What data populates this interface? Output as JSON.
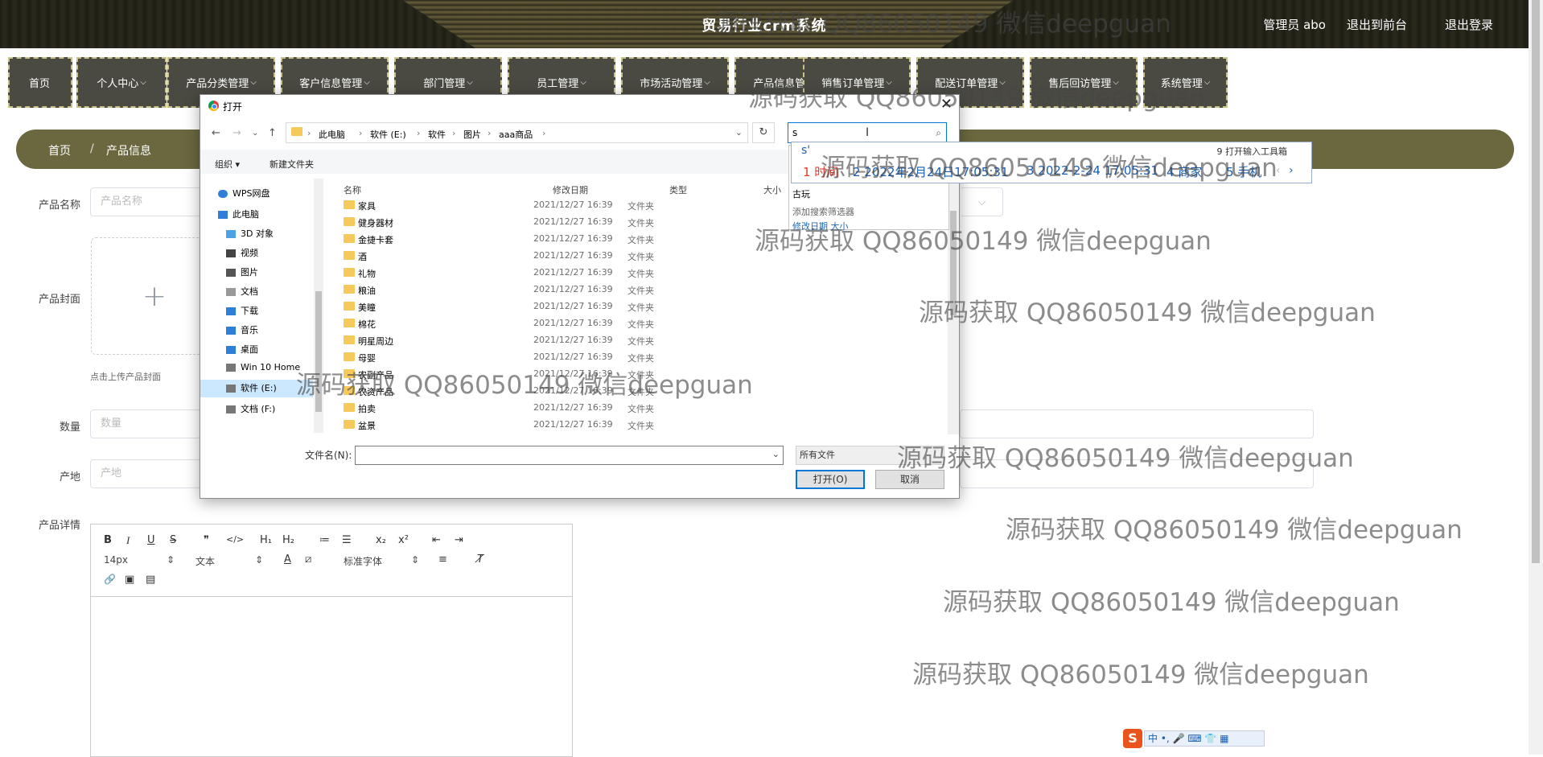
{
  "header": {
    "site_title": "贸易行业crm系统",
    "admin_label": "管理员 abo",
    "front_link": "退出到前台",
    "logout_link": "退出登录"
  },
  "nav": [
    {
      "label": "首页",
      "caret": ""
    },
    {
      "label": "个人中心",
      "caret": "⌵"
    },
    {
      "label": "产品分类管理",
      "caret": "⌵"
    },
    {
      "label": "客户信息管理",
      "caret": "⌵"
    },
    {
      "label": "部门管理",
      "caret": "⌵"
    },
    {
      "label": "员工管理",
      "caret": "⌵"
    },
    {
      "label": "市场活动管理",
      "caret": "⌵"
    },
    {
      "label": "产品信息管理",
      "caret": "⌵"
    },
    {
      "label": "销售订单管理",
      "caret": "⌵"
    },
    {
      "label": "配送订单管理",
      "caret": "⌵"
    },
    {
      "label": "售后回访管理",
      "caret": "⌵"
    },
    {
      "label": "系统管理",
      "caret": "⌵"
    }
  ],
  "breadcrumb": {
    "home": "首页",
    "separator": "/",
    "current": "产品信息"
  },
  "form": {
    "name_label": "产品名称",
    "name_placeholder": "产品名称",
    "cover_label": "产品封面",
    "cover_plus": "+",
    "cover_tip": "点击上传产品封面",
    "qty_label": "数量",
    "qty_placeholder": "数量",
    "origin_label": "产地",
    "origin_placeholder": "产地",
    "detail_label": "产品详情",
    "select_caret": "⌵"
  },
  "editor": {
    "bold": "B",
    "italic": "I",
    "underline": "U",
    "strike": "S",
    "quote": "❞",
    "code": "</>",
    "h1": "H₁",
    "h2": "H₂",
    "ol": "≔",
    "ul": "☰",
    "sub": "x₂",
    "sup": "x²",
    "outdent": "⇤",
    "indent": "⇥",
    "font_size": "14px",
    "text_type": "文本",
    "font_family": "标准字体",
    "align": "≡",
    "clear_format": "T̸",
    "link": "🔗",
    "image": "▣",
    "video": "▤",
    "sel_arrows": "⇕",
    "font_color": "A",
    "bg_color": "⧄"
  },
  "dialog": {
    "title": "打开",
    "close": "✕",
    "back": "←",
    "forward": "→",
    "down": "⌄",
    "up": "↑",
    "path": [
      "此电脑",
      "软件 (E:)",
      "软件",
      "图片",
      "aaa商品"
    ],
    "path_sep": "›",
    "addr_chevron": "⌄",
    "refresh": "↻",
    "search_value": "s",
    "search_icon": "⌕",
    "organize": "组织 ▾",
    "new_folder": "新建文件夹",
    "nav_pane": [
      {
        "label": "WPS网盘",
        "icon": "cloud-icon",
        "color": "#2f7fd8"
      },
      {
        "label": "此电脑",
        "icon": "computer-icon",
        "color": "#2f7fd8"
      },
      {
        "label": "3D 对象",
        "icon": "cube-icon",
        "color": "#4ba3e3"
      },
      {
        "label": "视频",
        "icon": "video-icon",
        "color": "#444"
      },
      {
        "label": "图片",
        "icon": "picture-icon",
        "color": "#444"
      },
      {
        "label": "文档",
        "icon": "document-icon",
        "color": "#888"
      },
      {
        "label": "下载",
        "icon": "download-icon",
        "color": "#2f7fd8"
      },
      {
        "label": "音乐",
        "icon": "music-icon",
        "color": "#2f7fd8"
      },
      {
        "label": "桌面",
        "icon": "desktop-icon",
        "color": "#2f7fd8"
      },
      {
        "label": "Win 10 Home",
        "icon": "drive-icon",
        "color": "#777"
      },
      {
        "label": "软件 (E:)",
        "icon": "drive-icon",
        "color": "#777",
        "selected": true
      },
      {
        "label": "文档 (F:)",
        "icon": "drive-icon",
        "color": "#777"
      }
    ],
    "columns": {
      "name": "名称",
      "date": "修改日期",
      "type": "类型",
      "size": "大小"
    },
    "files": [
      {
        "name": "家具",
        "date": "2021/12/27 16:39",
        "type": "文件夹"
      },
      {
        "name": "健身器材",
        "date": "2021/12/27 16:39",
        "type": "文件夹"
      },
      {
        "name": "金捷卡套",
        "date": "2021/12/27 16:39",
        "type": "文件夹"
      },
      {
        "name": "酒",
        "date": "2021/12/27 16:39",
        "type": "文件夹"
      },
      {
        "name": "礼物",
        "date": "2021/12/27 16:39",
        "type": "文件夹"
      },
      {
        "name": "粮油",
        "date": "2021/12/27 16:39",
        "type": "文件夹"
      },
      {
        "name": "美瞳",
        "date": "2021/12/27 16:39",
        "type": "文件夹"
      },
      {
        "name": "棉花",
        "date": "2021/12/27 16:39",
        "type": "文件夹"
      },
      {
        "name": "明星周边",
        "date": "2021/12/27 16:39",
        "type": "文件夹"
      },
      {
        "name": "母婴",
        "date": "2021/12/27 16:39",
        "type": "文件夹"
      },
      {
        "name": "农副产品",
        "date": "2021/12/27 16:39",
        "type": "文件夹"
      },
      {
        "name": "农资产品",
        "date": "2021/12/27 16:39",
        "type": "文件夹"
      },
      {
        "name": "拍卖",
        "date": "2021/12/27 16:39",
        "type": "文件夹"
      },
      {
        "name": "盆景",
        "date": "2021/12/27 16:39",
        "type": "文件夹"
      }
    ],
    "filename_label": "文件名(N):",
    "filename_value": "",
    "filetype": "所有文件",
    "open_button": "打开(O)",
    "cancel_button": "取消"
  },
  "search_suggest": {
    "item": "古玩",
    "add_filter": "添加搜索筛选器",
    "filters": "修改日期  大小"
  },
  "ime": {
    "typed": "s'",
    "toolbox": "9 打开输入工具箱",
    "candidates": [
      "1 时间",
      "2 2022年2月24日17:05:31",
      "3 2022-2-24 17:05:31",
      "4 商家",
      "5 手机"
    ],
    "prev": "‹",
    "next": "›",
    "status_logo": "S",
    "status_bar": "中 •, 🎤 ⌨ 👕 ▦"
  },
  "watermark": "源码获取 QQ86050149 微信deepguan"
}
